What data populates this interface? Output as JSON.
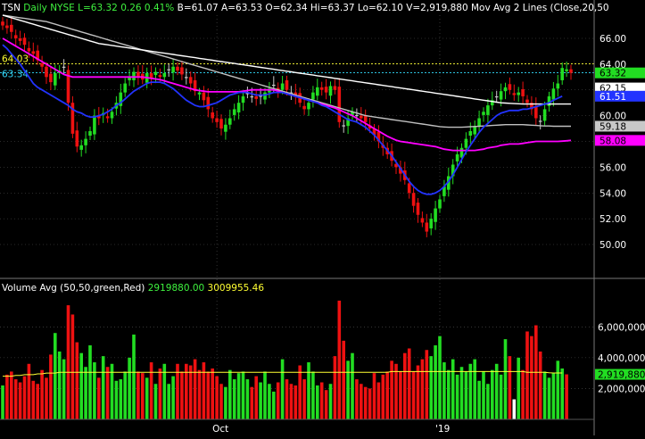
{
  "header": {
    "ticker": "TSN",
    "interval": "Daily",
    "exchange": "NYSE",
    "last": "L=63.32",
    "change": "0.26",
    "change_pct": "0.41%",
    "bid": "B=61.07",
    "ask": "A=63.53",
    "open": "O=62.34",
    "high": "Hi=63.37",
    "low": "Lo=62.10",
    "volume": "V=2,919,880",
    "study": "Mov Avg 2 Lines (Close,20,50"
  },
  "volume_header": {
    "label": "Volume Avg (50,50,green,Red)",
    "v1": "2919880.00",
    "v2": "3009955.46"
  },
  "price_axis": {
    "ticks": [
      "66.00",
      "64.00",
      "62.00",
      "60.00",
      "58.00",
      "56.00",
      "54.00",
      "52.00",
      "50.00"
    ],
    "tick_values": [
      66,
      64,
      62,
      60,
      58,
      56,
      54,
      52,
      50
    ],
    "ylim": [
      48.2,
      67.8
    ]
  },
  "volume_axis": {
    "ticks": [
      "6,000,000",
      "4,000,000",
      "2,000,000"
    ],
    "tick_values": [
      6000000,
      4000000,
      2000000
    ],
    "ylim": [
      0,
      8100000
    ]
  },
  "x_labels": [
    {
      "label": "Oct",
      "bar": 49
    },
    {
      "label": "'19",
      "bar": 100
    }
  ],
  "price_flags": [
    {
      "label": "63.32",
      "value": 63.32,
      "bg": "#22dd22",
      "fg": "#000000"
    },
    {
      "label": "62.15",
      "value": 62.15,
      "bg": "#ffffff",
      "fg": "#000000"
    },
    {
      "label": "61.51",
      "value": 61.51,
      "bg": "#2233ff",
      "fg": "#ffffff"
    },
    {
      "label": "59.18",
      "value": 59.18,
      "bg": "#c8c8c8",
      "fg": "#000000"
    },
    {
      "label": "58.08",
      "value": 58.08,
      "bg": "#ff00ff",
      "fg": "#000000"
    }
  ],
  "volume_flag": {
    "label": "2,919,880",
    "value": 2919880,
    "bg": "#22dd22",
    "fg": "#000000"
  },
  "ref_lines": [
    {
      "label": "64.03",
      "value": 64.03,
      "color": "#ffff33"
    },
    {
      "label": "63.34",
      "value": 63.34,
      "color": "#33ddff"
    }
  ],
  "colors": {
    "up": "#22dd22",
    "down": "#ee1111",
    "doji": "#c8c8c8",
    "ma20": "#2233ff",
    "ma50": "#ff00ff",
    "ma_white": "#ffffff",
    "ma_gray": "#c0c0c0",
    "vol_avg": "#ffff33",
    "grid": "#555555"
  },
  "chart_data": {
    "type": "candlestick",
    "grid": "horizontal, dotted",
    "closes": [
      67.0,
      66.8,
      66.5,
      66.0,
      65.8,
      65.5,
      65.0,
      64.8,
      64.3,
      63.8,
      63.0,
      62.6,
      63.3,
      63.5,
      63.8,
      61.0,
      58.6,
      57.6,
      57.7,
      58.2,
      58.8,
      60.0,
      59.8,
      60.2,
      59.8,
      60.3,
      61.0,
      61.8,
      62.5,
      63.0,
      63.4,
      63.0,
      62.8,
      63.3,
      62.9,
      63.4,
      63.0,
      63.3,
      63.6,
      63.8,
      63.5,
      63.2,
      63.0,
      62.5,
      61.9,
      61.8,
      61.2,
      60.5,
      59.8,
      59.5,
      59.0,
      59.3,
      59.8,
      60.5,
      61.0,
      61.5,
      61.7,
      61.5,
      61.3,
      61.5,
      61.8,
      62.1,
      62.4,
      62.0,
      62.5,
      62.0,
      61.8,
      61.5,
      61.0,
      60.5,
      61.0,
      61.8,
      62.2,
      62.0,
      61.8,
      62.3,
      62.0,
      59.5,
      59.2,
      59.8,
      60.3,
      60.0,
      59.8,
      59.5,
      59.0,
      58.5,
      58.0,
      57.5,
      57.0,
      56.5,
      56.0,
      55.5,
      55.0,
      54.0,
      53.0,
      52.3,
      51.7,
      51.0,
      52.0,
      52.8,
      53.5,
      54.5,
      55.3,
      56.2,
      57.0,
      57.5,
      58.2,
      58.8,
      59.2,
      59.8,
      60.3,
      60.8,
      61.2,
      61.5,
      61.9,
      62.2,
      62.0,
      61.6,
      61.8,
      61.5,
      61.0,
      60.5,
      59.8,
      59.6,
      60.5,
      61.5,
      62.1,
      62.5,
      63.7,
      63.6,
      63.32
    ],
    "ma20": [
      65.5,
      65.2,
      64.8,
      64.4,
      64.0,
      63.5,
      63.0,
      62.5,
      62.2,
      62.0,
      61.8,
      61.6,
      61.4,
      61.2,
      61.0,
      60.8,
      60.5,
      60.3,
      60.2,
      60.0,
      59.9,
      59.9,
      60.0,
      60.1,
      60.3,
      60.5,
      60.8,
      61.0,
      61.3,
      61.6,
      61.9,
      62.1,
      62.3,
      62.5,
      62.6,
      62.6,
      62.6,
      62.5,
      62.3,
      62.1,
      61.8,
      61.5,
      61.2,
      61.0,
      60.8,
      60.7,
      60.7,
      60.8,
      60.9,
      61.0,
      61.2,
      61.4,
      61.6,
      61.7,
      61.8,
      61.8,
      61.8,
      61.7,
      61.6,
      61.6,
      61.6,
      61.7,
      61.8,
      61.8,
      61.8,
      61.7,
      61.6,
      61.5,
      61.4,
      61.3,
      61.2,
      61.1,
      61.0,
      60.8,
      60.7,
      60.5,
      60.3,
      60.1,
      59.9,
      59.7,
      59.6,
      59.5,
      59.3,
      59.1,
      58.8,
      58.5,
      58.1,
      57.7,
      57.3,
      56.9,
      56.4,
      55.9,
      55.4,
      54.9,
      54.5,
      54.2,
      54.0,
      53.9,
      53.9,
      54.0,
      54.2,
      54.5,
      54.9,
      55.4,
      56.0,
      56.6,
      57.2,
      57.7,
      58.2,
      58.7,
      59.1,
      59.4,
      59.7,
      60.0,
      60.2,
      60.3,
      60.4,
      60.4,
      60.4,
      60.5,
      60.5,
      60.6,
      60.7,
      60.8,
      60.9,
      61.0,
      61.2,
      61.35,
      61.51
    ],
    "ma50": [
      66.0,
      65.8,
      65.6,
      65.4,
      65.2,
      65.0,
      64.8,
      64.6,
      64.4,
      64.2,
      64.0,
      63.8,
      63.6,
      63.4,
      63.2,
      63.1,
      63.0,
      63.0,
      63.0,
      63.0,
      63.0,
      63.0,
      63.0,
      63.0,
      63.0,
      63.0,
      63.0,
      63.0,
      63.0,
      63.0,
      63.0,
      63.0,
      63.0,
      62.95,
      62.9,
      62.85,
      62.8,
      62.7,
      62.6,
      62.5,
      62.4,
      62.3,
      62.2,
      62.1,
      62.0,
      61.95,
      61.9,
      61.85,
      61.85,
      61.85,
      61.85,
      61.85,
      61.85,
      61.85,
      61.85,
      61.9,
      61.95,
      62.0,
      62.0,
      62.0,
      62.0,
      62.0,
      62.0,
      61.9,
      61.8,
      61.7,
      61.6,
      61.5,
      61.4,
      61.3,
      61.2,
      61.1,
      61.0,
      60.9,
      60.8,
      60.7,
      60.6,
      60.45,
      60.3,
      60.15,
      60.0,
      59.8,
      59.6,
      59.4,
      59.2,
      59.0,
      58.8,
      58.6,
      58.4,
      58.25,
      58.1,
      58.0,
      57.95,
      57.9,
      57.85,
      57.8,
      57.75,
      57.7,
      57.65,
      57.6,
      57.5,
      57.4,
      57.35,
      57.3,
      57.3,
      57.3,
      57.3,
      57.3,
      57.3,
      57.35,
      57.4,
      57.5,
      57.55,
      57.6,
      57.7,
      57.75,
      57.8,
      57.8,
      57.8,
      57.85,
      57.9,
      57.95,
      58.0,
      58.0,
      58.0,
      58.0,
      58.0,
      58.0,
      58.02,
      58.05,
      58.08
    ],
    "ma_white": [
      67.8,
      67.7,
      67.6,
      67.5,
      67.4,
      67.3,
      67.2,
      67.1,
      67.0,
      66.9,
      66.8,
      66.7,
      66.6,
      66.5,
      66.4,
      66.3,
      66.2,
      66.1,
      66.0,
      65.9,
      65.8,
      65.7,
      65.6,
      65.55,
      65.5,
      65.45,
      65.4,
      65.35,
      65.3,
      65.25,
      65.2,
      65.15,
      65.1,
      65.05,
      65.0,
      64.95,
      64.9,
      64.85,
      64.8,
      64.75,
      64.7,
      64.65,
      64.6,
      64.55,
      64.5,
      64.45,
      64.4,
      64.35,
      64.3,
      64.25,
      64.2,
      64.15,
      64.1,
      64.05,
      64.0,
      63.95,
      63.9,
      63.85,
      63.8,
      63.75,
      63.7,
      63.65,
      63.6,
      63.55,
      63.5,
      63.45,
      63.4,
      63.35,
      63.3,
      63.25,
      63.2,
      63.15,
      63.1,
      63.05,
      63.0,
      62.95,
      62.9,
      62.85,
      62.8,
      62.75,
      62.7,
      62.65,
      62.6,
      62.55,
      62.5,
      62.45,
      62.4,
      62.35,
      62.3,
      62.25,
      62.2,
      62.15,
      62.1,
      62.05,
      62.0,
      61.95,
      61.9,
      61.85,
      61.8,
      61.75,
      61.7,
      61.65,
      61.6,
      61.55,
      61.5,
      61.45,
      61.4,
      61.35,
      61.3,
      61.25,
      61.2,
      61.15,
      61.1,
      61.05,
      61.0,
      60.98,
      60.96,
      60.94,
      60.92,
      60.9,
      60.9,
      60.9,
      60.9,
      60.9,
      60.9,
      60.9,
      60.9,
      60.9,
      60.9,
      60.9,
      60.9
    ],
    "ma_gray": [
      67.8,
      67.75,
      67.7,
      67.65,
      67.6,
      67.55,
      67.5,
      67.45,
      67.4,
      67.35,
      67.3,
      67.2,
      67.1,
      67.0,
      66.9,
      66.8,
      66.7,
      66.6,
      66.5,
      66.4,
      66.3,
      66.2,
      66.1,
      66.0,
      65.9,
      65.8,
      65.7,
      65.6,
      65.5,
      65.4,
      65.3,
      65.2,
      65.1,
      65.0,
      64.9,
      64.8,
      64.7,
      64.6,
      64.5,
      64.4,
      64.3,
      64.2,
      64.1,
      64.0,
      63.9,
      63.8,
      63.7,
      63.6,
      63.5,
      63.4,
      63.3,
      63.2,
      63.1,
      63.0,
      62.9,
      62.8,
      62.7,
      62.6,
      62.5,
      62.4,
      62.3,
      62.2,
      62.1,
      62.0,
      61.9,
      61.8,
      61.7,
      61.6,
      61.5,
      61.4,
      61.3,
      61.2,
      61.1,
      61.0,
      60.9,
      60.8,
      60.7,
      60.6,
      60.5,
      60.4,
      60.3,
      60.2,
      60.1,
      60.0,
      59.95,
      59.9,
      59.85,
      59.8,
      59.75,
      59.7,
      59.65,
      59.6,
      59.55,
      59.5,
      59.45,
      59.4,
      59.35,
      59.3,
      59.25,
      59.2,
      59.15,
      59.12,
      59.1,
      59.1,
      59.1,
      59.1,
      59.12,
      59.14,
      59.16,
      59.18,
      59.2,
      59.22,
      59.24,
      59.26,
      59.28,
      59.3,
      59.3,
      59.3,
      59.3,
      59.3,
      59.28,
      59.26,
      59.24,
      59.22,
      59.2,
      59.2,
      59.18,
      59.18,
      59.18,
      59.18,
      59.18
    ],
    "volume": [
      2.2,
      2.9,
      3.1,
      2.6,
      2.4,
      2.8,
      3.6,
      2.5,
      2.3,
      3.2,
      2.7,
      4.2,
      5.6,
      4.4,
      3.9,
      7.4,
      6.8,
      5.0,
      4.3,
      3.4,
      4.8,
      3.7,
      2.7,
      4.1,
      3.4,
      3.6,
      2.5,
      2.6,
      3.1,
      4.0,
      5.5,
      3.1,
      3.0,
      2.7,
      3.7,
      2.3,
      3.3,
      3.6,
      2.3,
      2.8,
      3.6,
      3.1,
      3.6,
      3.5,
      3.9,
      3.2,
      3.7,
      3.1,
      3.3,
      2.8,
      2.3,
      2.1,
      3.2,
      2.6,
      3.0,
      3.1,
      2.6,
      2.1,
      2.8,
      2.4,
      3.1,
      2.3,
      1.8,
      2.4,
      3.9,
      2.6,
      2.3,
      2.2,
      3.5,
      2.6,
      3.7,
      3.1,
      2.2,
      2.4,
      1.9,
      2.3,
      4.1,
      7.7,
      5.1,
      3.8,
      4.3,
      2.6,
      2.3,
      2.1,
      2.0,
      3.0,
      2.4,
      2.9,
      3.1,
      3.8,
      3.6,
      3.1,
      4.3,
      4.6,
      3.1,
      3.5,
      3.9,
      4.5,
      4.1,
      4.8,
      5.4,
      3.7,
      3.2,
      3.9,
      2.9,
      3.4,
      3.1,
      3.6,
      3.9,
      2.5,
      3.1,
      2.3,
      3.2,
      3.6,
      2.9,
      5.2,
      4.1,
      1.3,
      4.0,
      3.2,
      5.7,
      5.4,
      6.1,
      4.4,
      3.1,
      2.7,
      3.0,
      3.8,
      3.3,
      2.92
    ],
    "volume_avg": [
      2.8,
      2.8,
      2.8,
      2.85,
      2.85,
      2.9,
      2.9,
      2.9,
      2.95,
      2.95,
      3.0,
      3.0,
      3.0,
      3.05,
      3.05,
      3.05,
      3.05,
      3.05,
      3.05,
      3.05,
      3.05,
      3.05,
      3.05,
      3.05,
      3.05,
      3.05,
      3.05,
      3.05,
      3.05,
      3.05,
      3.05,
      3.05,
      3.05,
      3.05,
      3.05,
      3.05,
      3.05,
      3.05,
      3.05,
      3.05,
      3.05,
      3.05,
      3.05,
      3.05,
      3.05,
      3.05,
      3.05,
      3.05,
      3.05,
      3.05,
      3.05,
      3.05,
      3.05,
      3.05,
      3.05,
      3.05,
      3.05,
      3.05,
      3.05,
      3.05,
      3.05,
      3.05,
      3.05,
      3.05,
      3.05,
      3.05,
      3.05,
      3.05,
      3.05,
      3.05,
      3.05,
      3.05,
      3.05,
      3.05,
      3.05,
      3.05,
      3.05,
      3.05,
      3.05,
      3.05,
      3.05,
      3.05,
      3.05,
      3.05,
      3.05,
      3.05,
      3.05,
      3.05,
      3.05,
      3.1,
      3.1,
      3.1,
      3.1,
      3.1,
      3.1,
      3.1,
      3.1,
      3.1,
      3.1,
      3.1,
      3.1,
      3.1,
      3.1,
      3.1,
      3.1,
      3.1,
      3.1,
      3.1,
      3.1,
      3.1,
      3.1,
      3.1,
      3.1,
      3.1,
      3.1,
      3.1,
      3.1,
      3.1,
      3.1,
      3.1,
      3.05,
      3.05,
      3.05,
      3.05,
      3.05,
      3.02,
      3.01,
      3.01,
      3.01
    ]
  }
}
